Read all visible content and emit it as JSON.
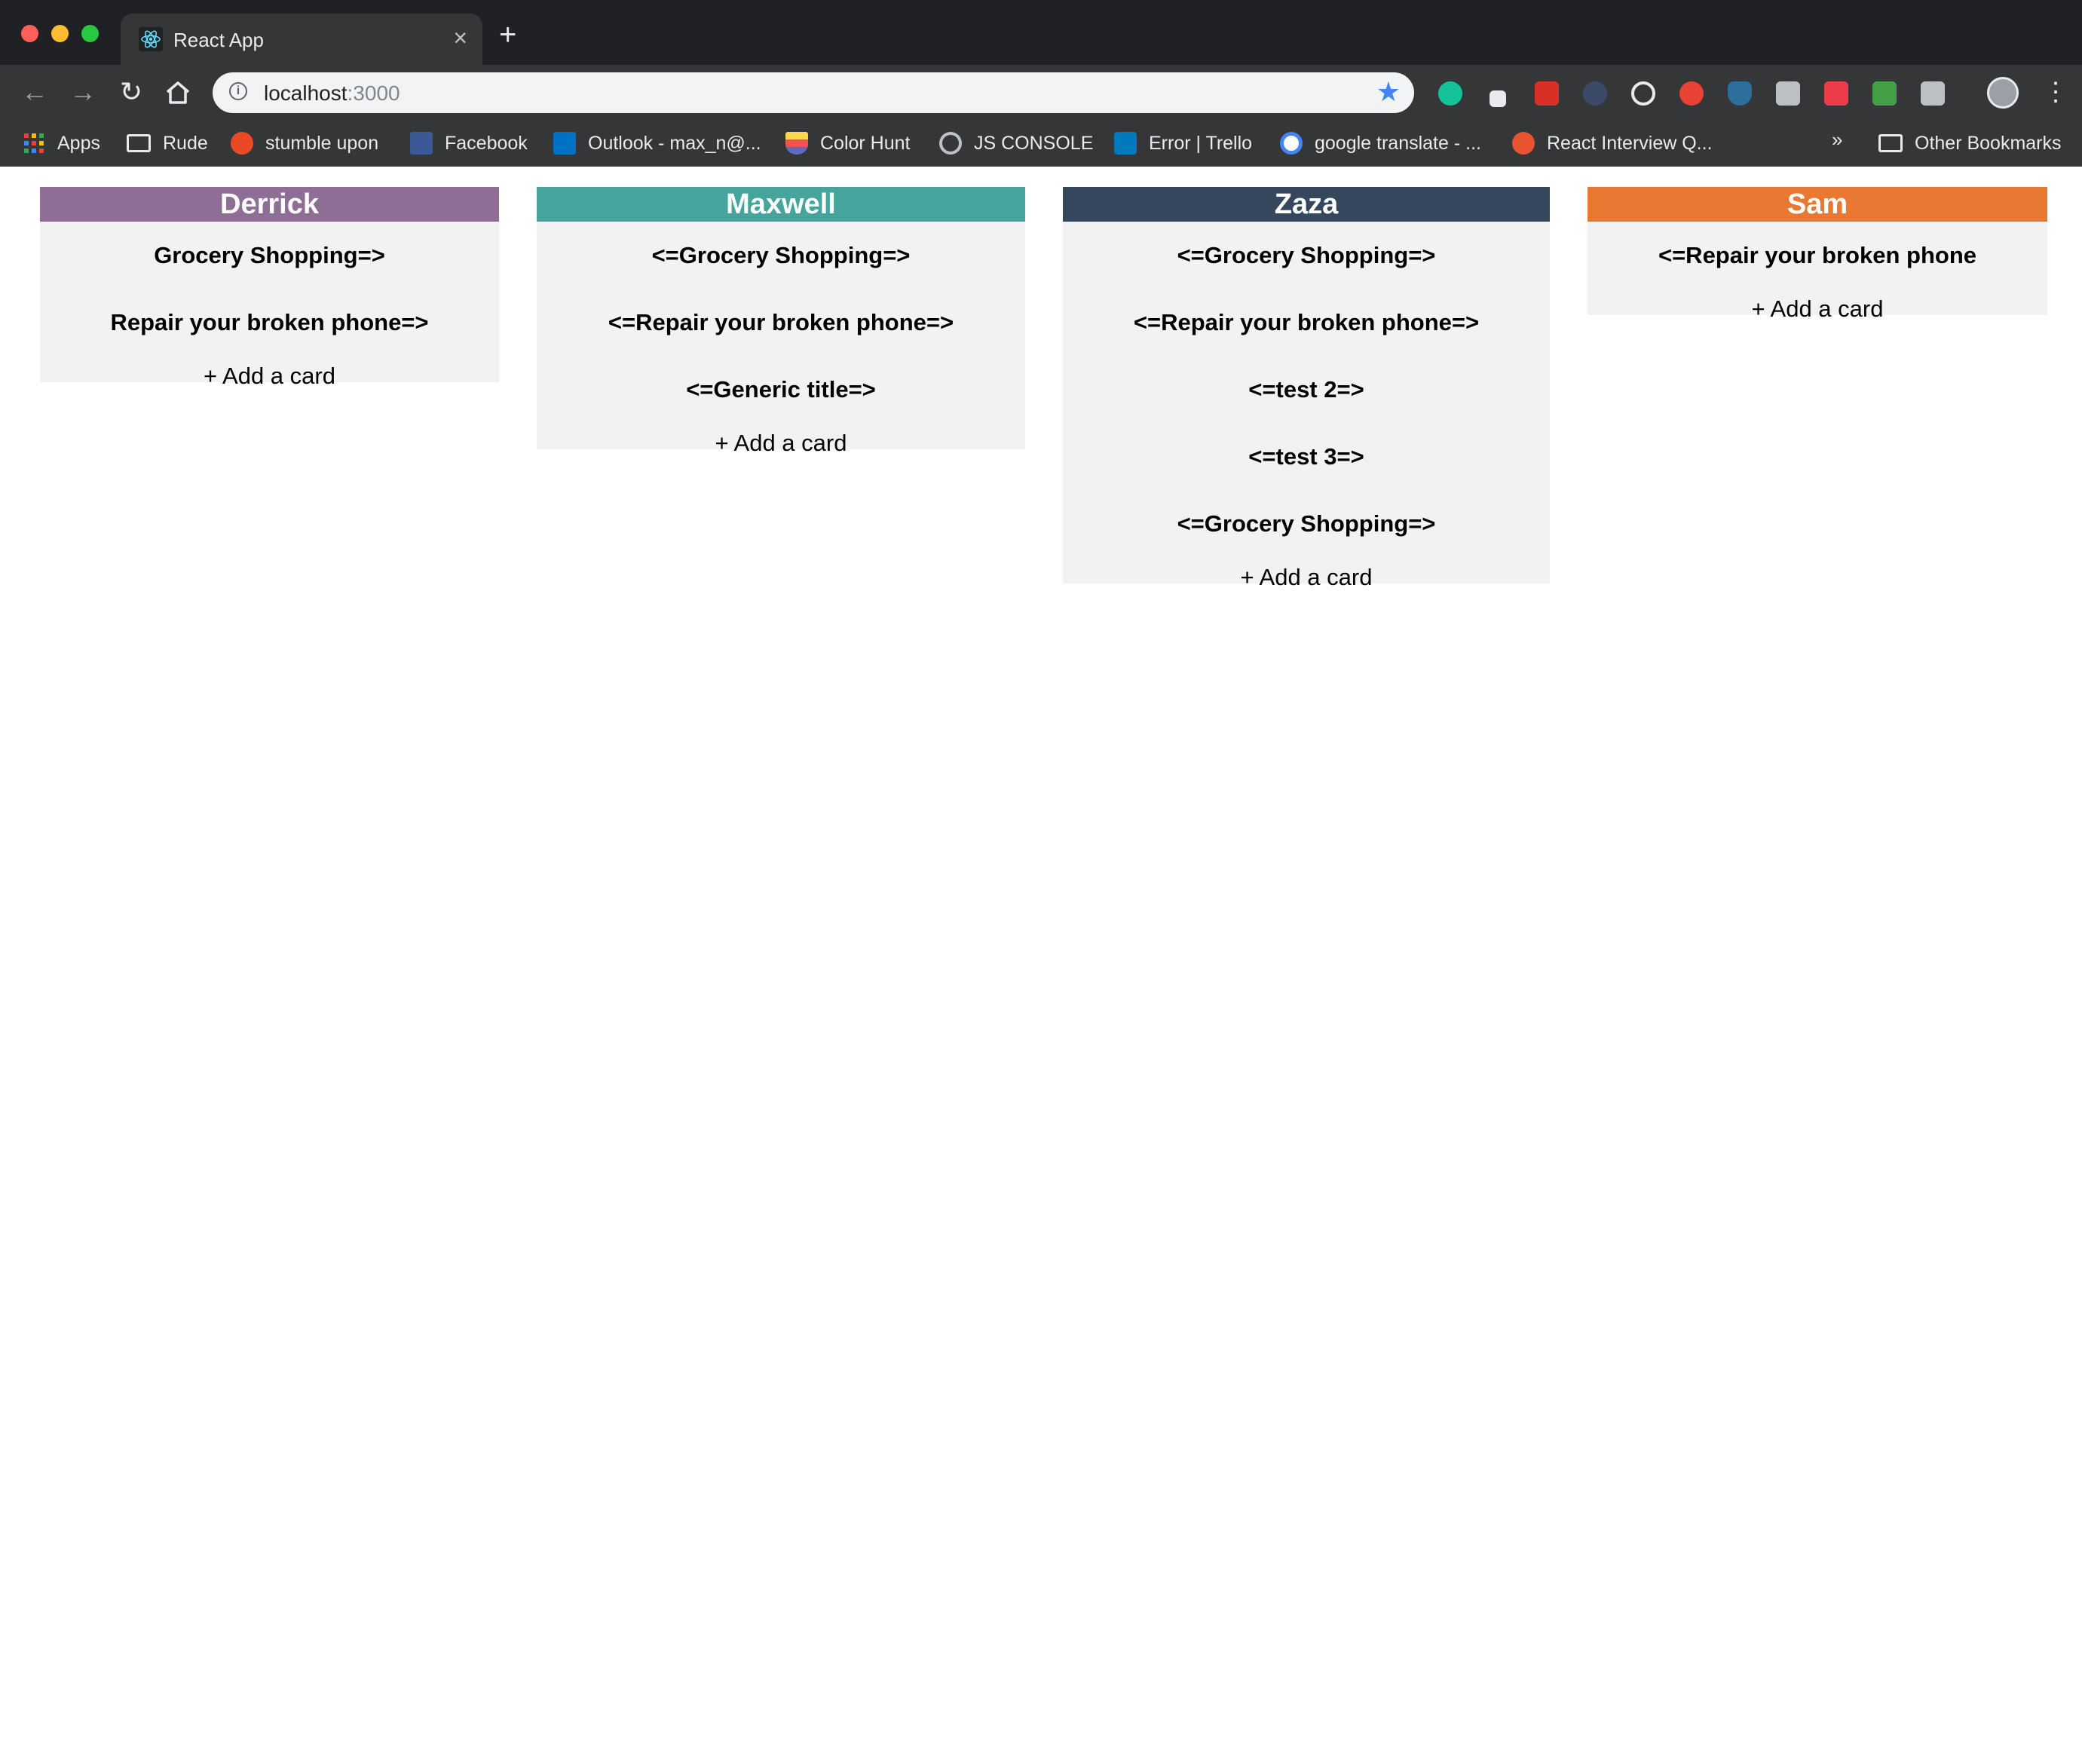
{
  "browser": {
    "tab_title": "React App",
    "url_host": "localhost",
    "url_port": ":3000",
    "bookmarks": [
      {
        "label": "Apps"
      },
      {
        "label": "Rude"
      },
      {
        "label": "stumble upon"
      },
      {
        "label": "Facebook"
      },
      {
        "label": "Outlook - max_n@..."
      },
      {
        "label": "Color Hunt"
      },
      {
        "label": "JS CONSOLE"
      },
      {
        "label": "Error | Trello"
      },
      {
        "label": "google translate - ..."
      },
      {
        "label": "React Interview Q..."
      }
    ],
    "more_bookmarks": "»",
    "other_bookmarks": "Other Bookmarks"
  },
  "columns": [
    {
      "name": "Derrick",
      "color": "#8e6e94",
      "cards": [
        "Grocery Shopping=>",
        "Repair your broken phone=>"
      ],
      "add_label": "+ Add a card"
    },
    {
      "name": "Maxwell",
      "color": "#45a59c",
      "cards": [
        "<=Grocery Shopping=>",
        "<=Repair your broken phone=>",
        "<=Generic title=>"
      ],
      "add_label": "+ Add a card"
    },
    {
      "name": "Zaza",
      "color": "#34475c",
      "cards": [
        "<=Grocery Shopping=>",
        "<=Repair your broken phone=>",
        "<=test 2=>",
        "<=test 3=>",
        "<=Grocery Shopping=>"
      ],
      "add_label": "+ Add a card"
    },
    {
      "name": "Sam",
      "color": "#e87832",
      "cards": [
        "<=Repair your broken phone"
      ],
      "add_label": "+ Add a card"
    }
  ]
}
